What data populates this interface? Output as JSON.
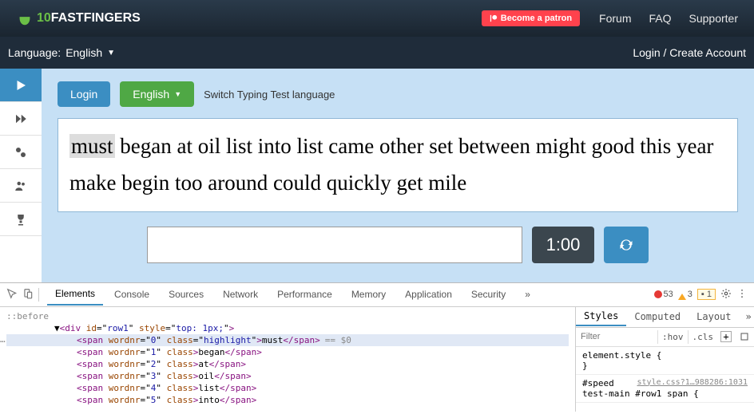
{
  "brand": {
    "ten": "10",
    "name": "FASTFINGERS"
  },
  "topnav": {
    "patron": "Become a patron",
    "links": [
      "Forum",
      "FAQ",
      "Supporter"
    ]
  },
  "secondbar": {
    "language_label": "Language:",
    "language_value": "English",
    "login_create": "Login / Create Account"
  },
  "controls": {
    "login": "Login",
    "english": "English",
    "switch": "Switch Typing Test language"
  },
  "words": [
    "must",
    "began",
    "at",
    "oil",
    "list",
    "into",
    "list",
    "came",
    "other",
    "set",
    "between",
    "might",
    "good",
    "this",
    "year",
    "make",
    "begin",
    "too",
    "around",
    "could",
    "quickly",
    "get",
    "mile"
  ],
  "highlight_index": 0,
  "timer": "1:00",
  "devtools": {
    "tabs": [
      "Elements",
      "Console",
      "Sources",
      "Network",
      "Performance",
      "Memory",
      "Application",
      "Security"
    ],
    "active_tab": "Elements",
    "errors": "53",
    "warnings": "3",
    "issues": "1",
    "dom": {
      "before": "::before",
      "row_open": {
        "id": "row1",
        "style": "top: 1px;"
      },
      "spans": [
        {
          "wordnr": "0",
          "cls": "highlight",
          "text": "must",
          "selected": true
        },
        {
          "wordnr": "1",
          "cls": "",
          "text": "began"
        },
        {
          "wordnr": "2",
          "cls": "",
          "text": "at"
        },
        {
          "wordnr": "3",
          "cls": "",
          "text": "oil"
        },
        {
          "wordnr": "4",
          "cls": "",
          "text": "list"
        },
        {
          "wordnr": "5",
          "cls": "",
          "text": "into"
        }
      ]
    },
    "styles": {
      "tabs": [
        "Styles",
        "Computed",
        "Layout"
      ],
      "filter_placeholder": "Filter",
      "hov": ":hov",
      "cls": ".cls",
      "element_style": "element.style {",
      "brace": "}",
      "rule_sel": "#speed test-main #row1 span {",
      "rule_src": "style.css?1…988286:1031"
    }
  }
}
